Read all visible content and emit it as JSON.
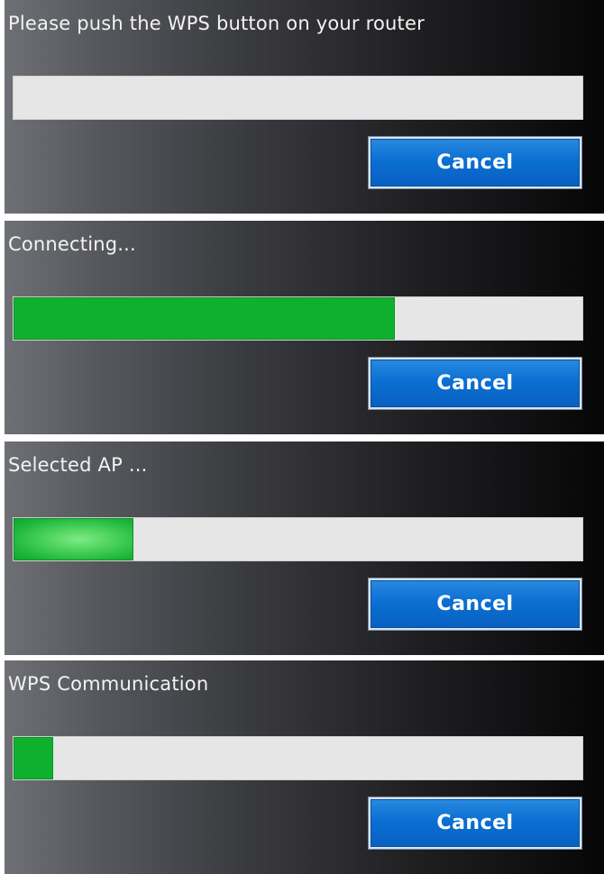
{
  "panels": [
    {
      "status": "Please push the WPS button on your router",
      "progress_percent": 0,
      "cancel_label": "Cancel"
    },
    {
      "status": "Connecting...",
      "progress_percent": 67,
      "cancel_label": "Cancel"
    },
    {
      "status": "Selected AP ...",
      "progress_percent": 21,
      "cancel_label": "Cancel"
    },
    {
      "status": "WPS Communication",
      "progress_percent": 7,
      "cancel_label": "Cancel"
    }
  ],
  "colors": {
    "progress_fill": "#0fb02e",
    "progress_track": "#e6e6e6",
    "button_blue": "#0b6fd3",
    "panel_dark": "#060607"
  }
}
